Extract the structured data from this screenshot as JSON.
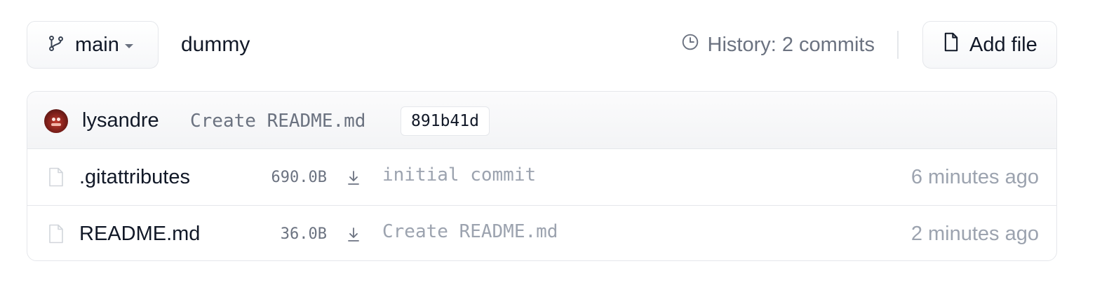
{
  "toolbar": {
    "branch_label": "main",
    "repo_name": "dummy",
    "history_label": "History: 2 commits",
    "add_file_label": "Add file"
  },
  "last_commit": {
    "author": "lysandre",
    "message": "Create README.md",
    "hash": "891b41d"
  },
  "files": [
    {
      "name": ".gitattributes",
      "size": "690.0B",
      "commit_message": "initial commit",
      "time": "6 minutes ago"
    },
    {
      "name": "README.md",
      "size": "36.0B",
      "commit_message": "Create README.md",
      "time": "2 minutes ago"
    }
  ],
  "icons": {
    "branch": "branch-icon",
    "history": "clock-icon",
    "add_file": "file-icon",
    "download": "download-icon"
  },
  "colors": {
    "border": "#e5e7eb",
    "text_primary": "#111827",
    "text_muted": "#6b7280",
    "text_faint": "#9ca3af"
  }
}
